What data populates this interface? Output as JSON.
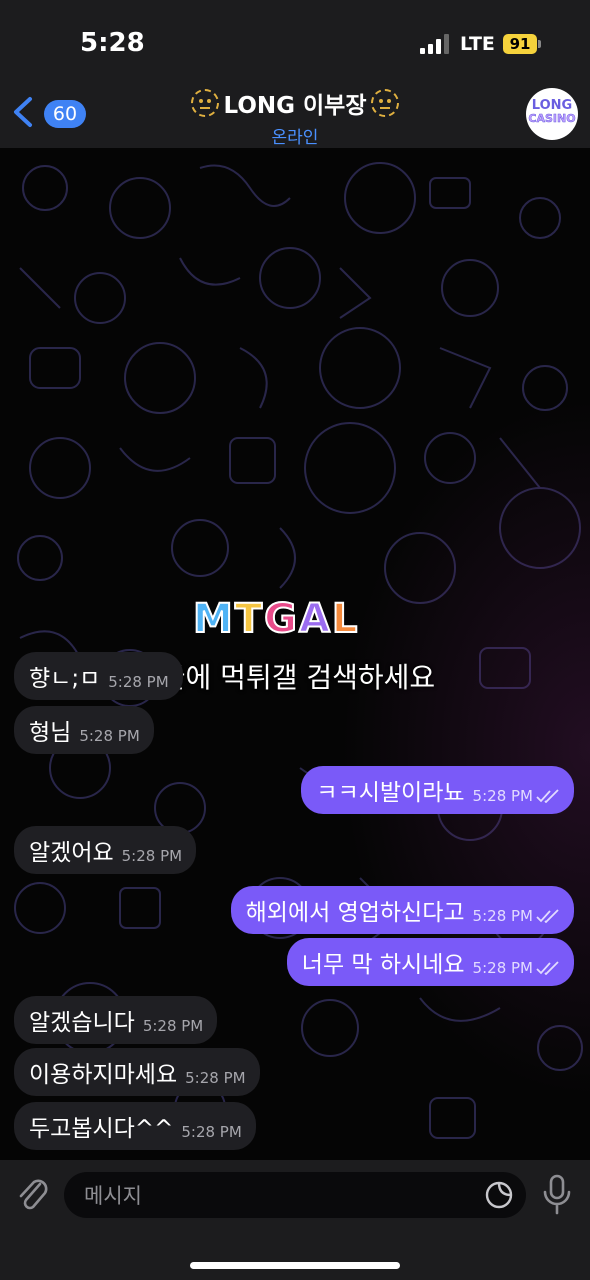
{
  "status_bar": {
    "time": "5:28",
    "network": "LTE",
    "battery": "91"
  },
  "header": {
    "back_count": "60",
    "title": "LONG 이부장",
    "status": "온라인",
    "avatar_line1": "LONG",
    "avatar_line2": "CASINO"
  },
  "watermark": {
    "logo": [
      "M",
      "T",
      "G",
      "A",
      "L"
    ],
    "text": "구글에 먹튀갤 검색하세요"
  },
  "messages": [
    {
      "dir": "in",
      "text": "향ㄴ;ㅁ",
      "time": "5:28 PM"
    },
    {
      "dir": "in",
      "text": "형님",
      "time": "5:28 PM"
    },
    {
      "dir": "out",
      "text": "ㅋㅋ시발이라뇨",
      "time": "5:28 PM"
    },
    {
      "dir": "in",
      "text": "알겠어요",
      "time": "5:28 PM"
    },
    {
      "dir": "out",
      "text": "해외에서 영업하신다고",
      "time": "5:28 PM"
    },
    {
      "dir": "out",
      "text": "너무 막 하시네요",
      "time": "5:28 PM"
    },
    {
      "dir": "in",
      "text": "알겠습니다",
      "time": "5:28 PM"
    },
    {
      "dir": "in",
      "text": "이용하지마세요",
      "time": "5:28 PM"
    },
    {
      "dir": "in",
      "text": "두고봅시다^^",
      "time": "5:28 PM"
    }
  ],
  "input": {
    "placeholder": "메시지"
  },
  "colors": {
    "outgoing": "#7a5af8",
    "incoming": "#1f1f23",
    "accent": "#3f82f4",
    "logo": [
      "#4fb3f5",
      "#f5c542",
      "#e94b8a",
      "#9b6cf0",
      "#f58a3c"
    ]
  }
}
